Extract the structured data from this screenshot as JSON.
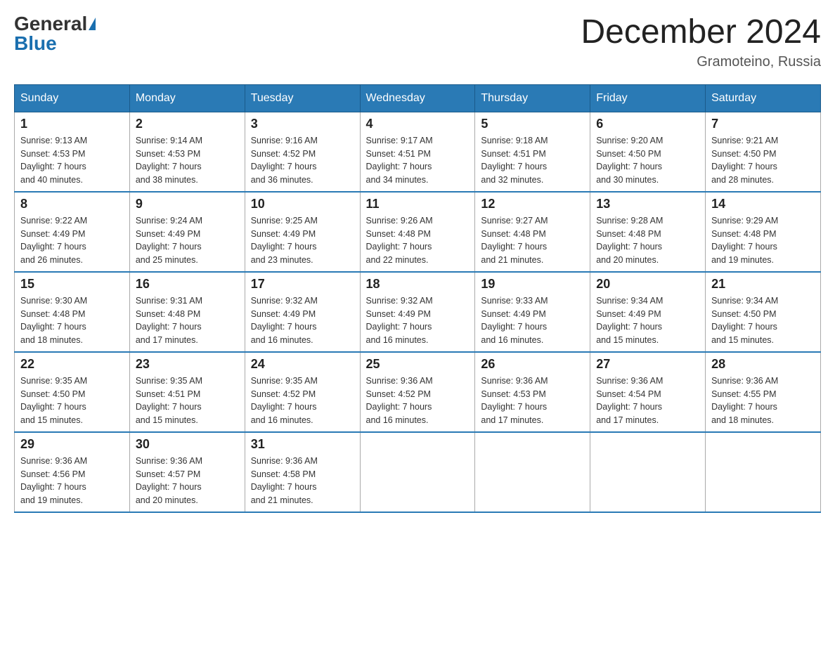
{
  "logo": {
    "general": "General",
    "blue": "Blue"
  },
  "title": "December 2024",
  "subtitle": "Gramoteino, Russia",
  "days_of_week": [
    "Sunday",
    "Monday",
    "Tuesday",
    "Wednesday",
    "Thursday",
    "Friday",
    "Saturday"
  ],
  "weeks": [
    [
      {
        "day": "1",
        "sunrise": "9:13 AM",
        "sunset": "4:53 PM",
        "daylight": "7 hours and 40 minutes."
      },
      {
        "day": "2",
        "sunrise": "9:14 AM",
        "sunset": "4:53 PM",
        "daylight": "7 hours and 38 minutes."
      },
      {
        "day": "3",
        "sunrise": "9:16 AM",
        "sunset": "4:52 PM",
        "daylight": "7 hours and 36 minutes."
      },
      {
        "day": "4",
        "sunrise": "9:17 AM",
        "sunset": "4:51 PM",
        "daylight": "7 hours and 34 minutes."
      },
      {
        "day": "5",
        "sunrise": "9:18 AM",
        "sunset": "4:51 PM",
        "daylight": "7 hours and 32 minutes."
      },
      {
        "day": "6",
        "sunrise": "9:20 AM",
        "sunset": "4:50 PM",
        "daylight": "7 hours and 30 minutes."
      },
      {
        "day": "7",
        "sunrise": "9:21 AM",
        "sunset": "4:50 PM",
        "daylight": "7 hours and 28 minutes."
      }
    ],
    [
      {
        "day": "8",
        "sunrise": "9:22 AM",
        "sunset": "4:49 PM",
        "daylight": "7 hours and 26 minutes."
      },
      {
        "day": "9",
        "sunrise": "9:24 AM",
        "sunset": "4:49 PM",
        "daylight": "7 hours and 25 minutes."
      },
      {
        "day": "10",
        "sunrise": "9:25 AM",
        "sunset": "4:49 PM",
        "daylight": "7 hours and 23 minutes."
      },
      {
        "day": "11",
        "sunrise": "9:26 AM",
        "sunset": "4:48 PM",
        "daylight": "7 hours and 22 minutes."
      },
      {
        "day": "12",
        "sunrise": "9:27 AM",
        "sunset": "4:48 PM",
        "daylight": "7 hours and 21 minutes."
      },
      {
        "day": "13",
        "sunrise": "9:28 AM",
        "sunset": "4:48 PM",
        "daylight": "7 hours and 20 minutes."
      },
      {
        "day": "14",
        "sunrise": "9:29 AM",
        "sunset": "4:48 PM",
        "daylight": "7 hours and 19 minutes."
      }
    ],
    [
      {
        "day": "15",
        "sunrise": "9:30 AM",
        "sunset": "4:48 PM",
        "daylight": "7 hours and 18 minutes."
      },
      {
        "day": "16",
        "sunrise": "9:31 AM",
        "sunset": "4:48 PM",
        "daylight": "7 hours and 17 minutes."
      },
      {
        "day": "17",
        "sunrise": "9:32 AM",
        "sunset": "4:49 PM",
        "daylight": "7 hours and 16 minutes."
      },
      {
        "day": "18",
        "sunrise": "9:32 AM",
        "sunset": "4:49 PM",
        "daylight": "7 hours and 16 minutes."
      },
      {
        "day": "19",
        "sunrise": "9:33 AM",
        "sunset": "4:49 PM",
        "daylight": "7 hours and 16 minutes."
      },
      {
        "day": "20",
        "sunrise": "9:34 AM",
        "sunset": "4:49 PM",
        "daylight": "7 hours and 15 minutes."
      },
      {
        "day": "21",
        "sunrise": "9:34 AM",
        "sunset": "4:50 PM",
        "daylight": "7 hours and 15 minutes."
      }
    ],
    [
      {
        "day": "22",
        "sunrise": "9:35 AM",
        "sunset": "4:50 PM",
        "daylight": "7 hours and 15 minutes."
      },
      {
        "day": "23",
        "sunrise": "9:35 AM",
        "sunset": "4:51 PM",
        "daylight": "7 hours and 15 minutes."
      },
      {
        "day": "24",
        "sunrise": "9:35 AM",
        "sunset": "4:52 PM",
        "daylight": "7 hours and 16 minutes."
      },
      {
        "day": "25",
        "sunrise": "9:36 AM",
        "sunset": "4:52 PM",
        "daylight": "7 hours and 16 minutes."
      },
      {
        "day": "26",
        "sunrise": "9:36 AM",
        "sunset": "4:53 PM",
        "daylight": "7 hours and 17 minutes."
      },
      {
        "day": "27",
        "sunrise": "9:36 AM",
        "sunset": "4:54 PM",
        "daylight": "7 hours and 17 minutes."
      },
      {
        "day": "28",
        "sunrise": "9:36 AM",
        "sunset": "4:55 PM",
        "daylight": "7 hours and 18 minutes."
      }
    ],
    [
      {
        "day": "29",
        "sunrise": "9:36 AM",
        "sunset": "4:56 PM",
        "daylight": "7 hours and 19 minutes."
      },
      {
        "day": "30",
        "sunrise": "9:36 AM",
        "sunset": "4:57 PM",
        "daylight": "7 hours and 20 minutes."
      },
      {
        "day": "31",
        "sunrise": "9:36 AM",
        "sunset": "4:58 PM",
        "daylight": "7 hours and 21 minutes."
      },
      null,
      null,
      null,
      null
    ]
  ],
  "labels": {
    "sunrise_prefix": "Sunrise: ",
    "sunset_prefix": "Sunset: ",
    "daylight_prefix": "Daylight: "
  }
}
